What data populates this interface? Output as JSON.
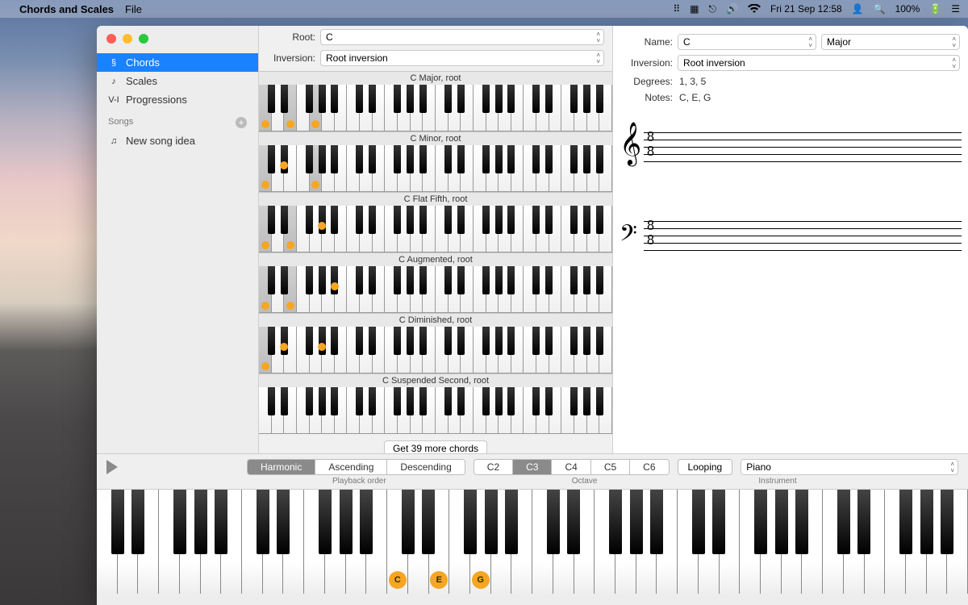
{
  "menubar": {
    "app_name": "Chords and Scales",
    "file": "File",
    "datetime": "Fri 21 Sep  12:58",
    "battery": "100%"
  },
  "sidebar": {
    "items": [
      {
        "label": "Chords",
        "selected": true,
        "icon": "§"
      },
      {
        "label": "Scales",
        "selected": false,
        "icon": "♪"
      },
      {
        "label": "Progressions",
        "selected": false,
        "icon": "V-I"
      }
    ],
    "songs_header": "Songs",
    "songs": [
      {
        "label": "New song idea",
        "icon": "♫"
      }
    ]
  },
  "center": {
    "root_label": "Root:",
    "root_value": "C",
    "inversion_label": "Inversion:",
    "inversion_value": "Root inversion",
    "chords": [
      {
        "title": "C Major, root",
        "highlights": [
          0,
          2,
          4
        ],
        "black_marks": []
      },
      {
        "title": "C Minor, root",
        "highlights": [
          0,
          4
        ],
        "black_marks": [
          1
        ]
      },
      {
        "title": "C Flat Fifth, root",
        "highlights": [
          0,
          2
        ],
        "black_marks": [
          3
        ]
      },
      {
        "title": "C Augmented, root",
        "highlights": [
          0,
          2
        ],
        "black_marks": [
          4
        ]
      },
      {
        "title": "C Diminished, root",
        "highlights": [
          0
        ],
        "black_marks": [
          1,
          3
        ]
      },
      {
        "title": "C Suspended Second, root",
        "highlights": [],
        "black_marks": []
      }
    ],
    "more_label": "Get 39 more chords"
  },
  "detail": {
    "name_label": "Name:",
    "name_root": "C",
    "name_quality": "Major",
    "inversion_label": "Inversion:",
    "inversion_value": "Root inversion",
    "degrees_label": "Degrees:",
    "degrees_value": "1, 3, 5",
    "notes_label": "Notes:",
    "notes_value": "C, E, G"
  },
  "playback": {
    "order_label": "Playback order",
    "order": [
      "Harmonic",
      "Ascending",
      "Descending"
    ],
    "order_selected": "Harmonic",
    "octave_label": "Octave",
    "octaves": [
      "C2",
      "C3",
      "C4",
      "C5",
      "C6"
    ],
    "octave_selected": "C3",
    "looping": "Looping",
    "instrument_label": "Instrument",
    "instrument": "Piano"
  },
  "big_keyboard": {
    "marks": [
      {
        "label": "C",
        "white_index": 14
      },
      {
        "label": "E",
        "white_index": 16
      },
      {
        "label": "G",
        "white_index": 18
      }
    ]
  }
}
